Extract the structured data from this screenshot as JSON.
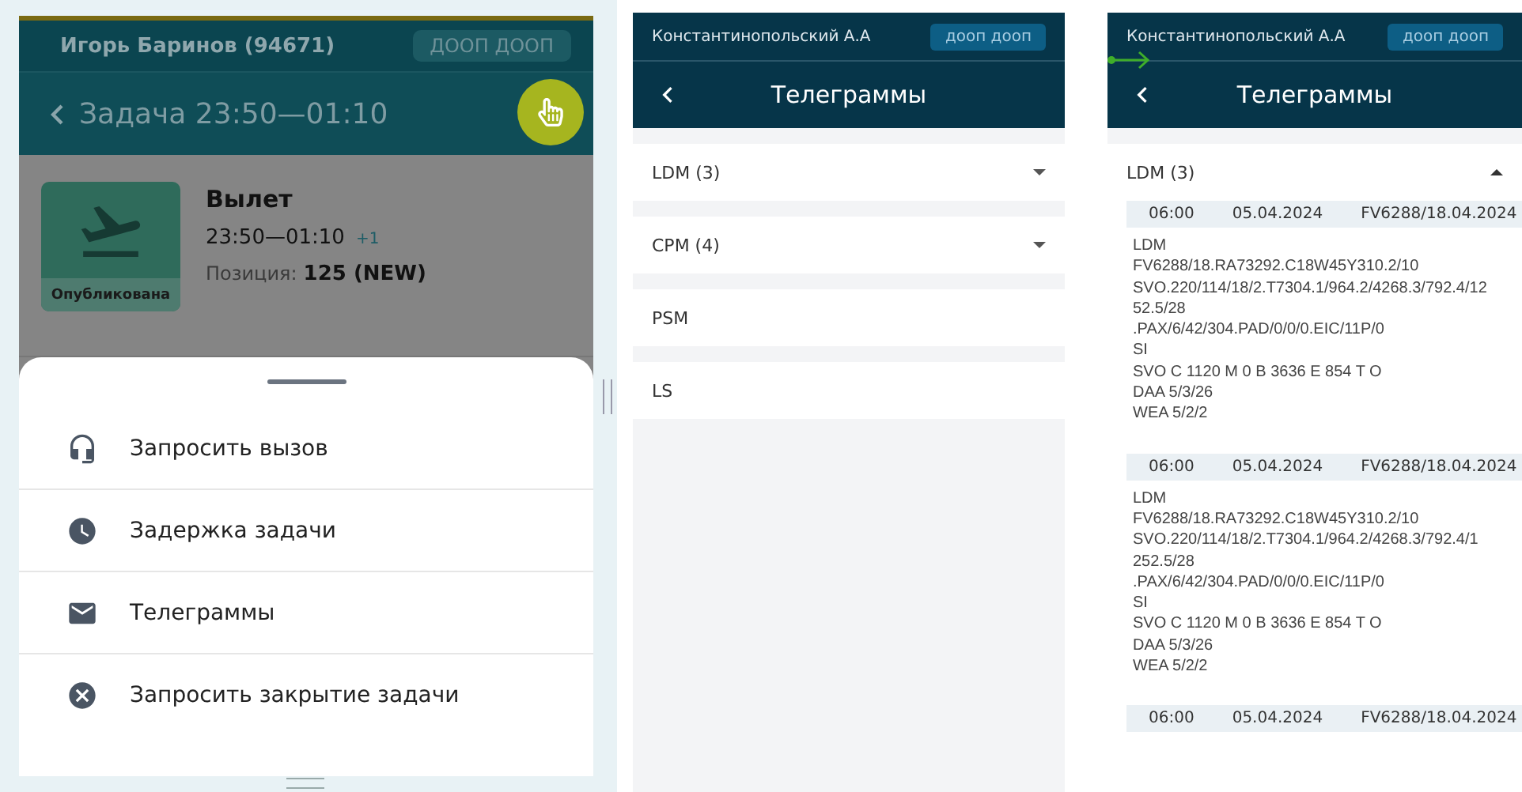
{
  "task_screen": {
    "user": "Игорь Баринов (94671)",
    "user_button": "ДООП ДООП",
    "title": "Задача 23:50—01:10",
    "task": {
      "status": "Опубликована",
      "name": "Вылет",
      "time": "23:50—01:10",
      "day_offset": "+1",
      "position_label": "Позиция:",
      "position_value": "125 (NEW)"
    },
    "menu": [
      {
        "kind": "headset",
        "label": "Запросить вызов"
      },
      {
        "kind": "clock",
        "label": "Задержка задачи"
      },
      {
        "kind": "mail",
        "label": "Телеграммы"
      },
      {
        "kind": "cancel",
        "label": "Запросить закрытие задачи"
      }
    ]
  },
  "telegram_list_screen": {
    "user": "Константинопольский А.А",
    "user_button": "дооп дооп",
    "title": "Телеграммы",
    "groups": [
      {
        "label": "LDM (3)",
        "expanded": false
      },
      {
        "label": "CPM (4)",
        "expanded": false
      },
      {
        "label": "PSM"
      },
      {
        "label": "LS"
      }
    ]
  },
  "telegram_detail_screen": {
    "user": "Константинопольский А.А",
    "user_button": "дооп дооп",
    "title": "Телеграммы",
    "group": {
      "label": "LDM (3)",
      "expanded": true
    },
    "messages": [
      {
        "time": "06:00",
        "date": "05.04.2024",
        "flight": "FV6288/18.04.2024",
        "lines": [
          "LDM",
          "FV6288/18.RA73292.C18W45Y310.2/10",
          "SVO.220/114/18/2.T7304.1/964.2/4268.3/792.4/12",
          "52.5/28",
          ".PAX/6/42/304.PAD/0/0/0.EIC/11P/0",
          "SI",
          "SVO C 1120 M 0 B 3636 E 854 T O",
          "DAA 5/3/26",
          "WEA 5/2/2"
        ]
      },
      {
        "time": "06:00",
        "date": "05.04.2024",
        "flight": "FV6288/18.04.2024",
        "lines": [
          "LDM",
          "FV6288/18.RA73292.C18W45Y310.2/10",
          "SVO.220/114/18/2.T7304.1/964.2/4268.3/792.4/1",
          "252.5/28",
          ".PAX/6/42/304.PAD/0/0/0.EIC/11P/0",
          "SI",
          "SVO C 1120 M 0 B 3636 E 854 T O",
          "DAA 5/3/26",
          "WEA 5/2/2"
        ]
      },
      {
        "time": "06:00",
        "date": "05.04.2024",
        "flight": "FV6288/18.04.2024"
      }
    ]
  }
}
